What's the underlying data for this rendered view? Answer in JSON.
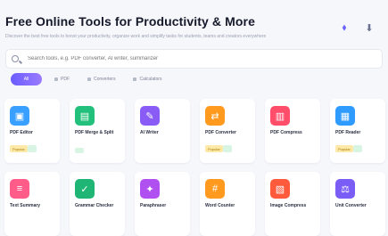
{
  "header": {
    "title": "Free Online Tools for Productivity & More",
    "subtitle": "Discover the best free tools to boost your productivity, organize work and simplify tasks for students, teams and creators everywhere"
  },
  "search": {
    "placeholder": "Search tools, e.g. PDF converter, AI writer, summarizer"
  },
  "tabs": [
    {
      "label": "All"
    },
    {
      "label": "PDF"
    },
    {
      "label": "Converters"
    },
    {
      "label": "Calculators"
    }
  ],
  "cards": [
    {
      "name": "PDF Editor",
      "badge": "Popular",
      "icon": "document-icon",
      "color": "#3aa0ff",
      "glyph": "▣"
    },
    {
      "name": "PDF Merge & Split",
      "badge": "",
      "icon": "merge-icon",
      "color": "#22c07a",
      "glyph": "▤"
    },
    {
      "name": "AI Writer",
      "badge": "",
      "icon": "pen-icon",
      "color": "#8a5cf6",
      "glyph": "✎"
    },
    {
      "name": "PDF Converter",
      "badge": "Popular",
      "icon": "convert-icon",
      "color": "#ff9a1f",
      "glyph": "⇄"
    },
    {
      "name": "PDF Compress",
      "badge": "",
      "icon": "compress-icon",
      "color": "#ff4d6a",
      "glyph": "▥"
    },
    {
      "name": "PDF Reader",
      "badge": "Popular",
      "icon": "reader-icon",
      "color": "#2f9bff",
      "glyph": "▦"
    },
    {
      "name": "Text Summary",
      "badge": "",
      "icon": "text-icon",
      "color": "#ff5c8a",
      "glyph": "≡"
    },
    {
      "name": "Grammar Checker",
      "badge": "",
      "icon": "check-icon",
      "color": "#1fb574",
      "glyph": "✓"
    },
    {
      "name": "Paraphraser",
      "badge": "",
      "icon": "wand-icon",
      "color": "#b050f0",
      "glyph": "✦"
    },
    {
      "name": "Word Counter",
      "badge": "",
      "icon": "count-icon",
      "color": "#ff9a1f",
      "glyph": "#"
    },
    {
      "name": "Image Compress",
      "badge": "",
      "icon": "image-icon",
      "color": "#ff5a3c",
      "glyph": "▧"
    },
    {
      "name": "Unit Converter",
      "badge": "",
      "icon": "unit-icon",
      "color": "#7a5cf6",
      "glyph": "⚖"
    }
  ]
}
